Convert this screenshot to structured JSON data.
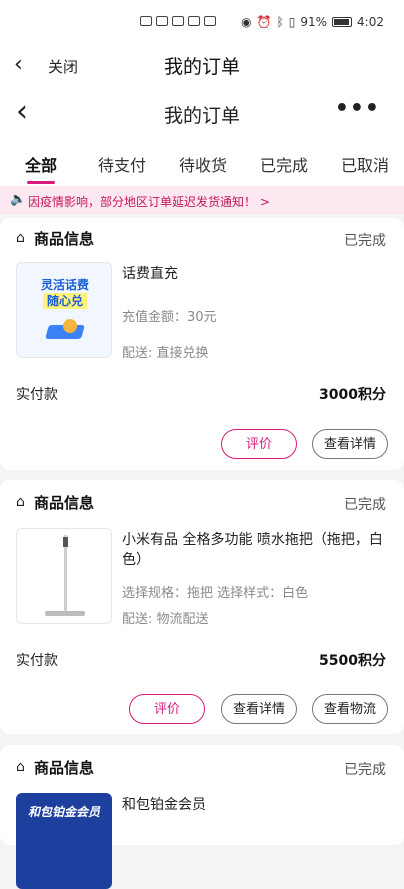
{
  "status_bar": {
    "battery": "91%",
    "time": "4:02"
  },
  "top_bar": {
    "back_icon": "chevron-left-icon",
    "close_label": "关闭",
    "title": "我的订单"
  },
  "nav_bar": {
    "title": "我的订单",
    "more_icon": "more-icon"
  },
  "tabs": [
    "全部",
    "待支付",
    "待收货",
    "已完成",
    "已取消"
  ],
  "notice": {
    "text": "因疫情影响，部分地区订单延迟发货通知！ >"
  },
  "orders": [
    {
      "section_title": "商品信息",
      "status": "已完成",
      "thumb_lines": [
        "灵活话费",
        "随心兑"
      ],
      "product_name": "话费直充",
      "meta1": "充值金额：30元",
      "meta2": "配送: 直接兑换",
      "pay_label": "实付款",
      "pay_value": "3000积分",
      "buttons": [
        "评价",
        "查看详情"
      ]
    },
    {
      "section_title": "商品信息",
      "status": "已完成",
      "product_name": "小米有品 全格多功能 喷水拖把（拖把，白色）",
      "meta1": "选择规格：拖把  选择样式：白色",
      "meta2": "配送: 物流配送",
      "pay_label": "实付款",
      "pay_value": "5500积分",
      "buttons": [
        "评价",
        "查看详情",
        "查看物流"
      ]
    },
    {
      "section_title": "商品信息",
      "status": "已完成",
      "thumb_text": "和包铂金会员",
      "product_name": "和包铂金会员"
    }
  ],
  "colors": {
    "accent": "#d81b7d",
    "notice_bg": "#fde8f1"
  }
}
